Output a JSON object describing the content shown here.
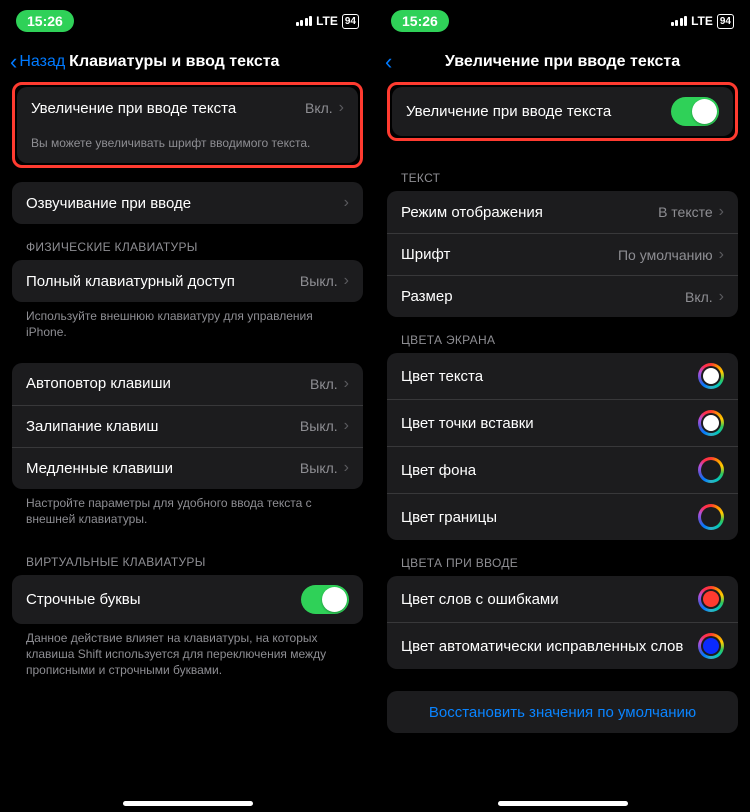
{
  "status": {
    "time": "15:26",
    "network": "LTE",
    "battery": "94"
  },
  "left": {
    "back_label": "Назад",
    "title": "Клавиатуры и ввод текста",
    "hover": {
      "label": "Увеличение при вводе текста",
      "value": "Вкл.",
      "footer": "Вы можете увеличивать шрифт вводимого текста."
    },
    "speak": {
      "label": "Озвучивание при вводе"
    },
    "phys_header": "ФИЗИЧЕСКИЕ КЛАВИАТУРЫ",
    "fullkb": {
      "label": "Полный клавиатурный доступ",
      "value": "Выкл."
    },
    "phys_footer": "Используйте внешнюю клавиатуру для управления iPhone.",
    "keyrepeat": {
      "label": "Автоповтор клавиши",
      "value": "Вкл."
    },
    "sticky": {
      "label": "Залипание клавиш",
      "value": "Выкл."
    },
    "slow": {
      "label": "Медленные клавиши",
      "value": "Выкл."
    },
    "ext_footer": "Настройте параметры для удобного ввода текста с внешней клавиатуры.",
    "virt_header": "ВИРТУАЛЬНЫЕ КЛАВИАТУРЫ",
    "lowercase": {
      "label": "Строчные буквы"
    },
    "virt_footer": "Данное действие влияет на клавиатуры, на которых клавиша Shift используется для переключения между прописными и строчными буквами."
  },
  "right": {
    "title": "Увеличение при вводе текста",
    "main": {
      "label": "Увеличение при вводе текста"
    },
    "text_header": "ТЕКСТ",
    "display_mode": {
      "label": "Режим отображения",
      "value": "В тексте"
    },
    "font": {
      "label": "Шрифт",
      "value": "По умолчанию"
    },
    "size": {
      "label": "Размер",
      "value": "Вкл."
    },
    "screen_header": "ЦВЕТА ЭКРАНА",
    "text_color": {
      "label": "Цвет текста"
    },
    "insert_color": {
      "label": "Цвет точки вставки"
    },
    "bg_color": {
      "label": "Цвет фона"
    },
    "border_color": {
      "label": "Цвет границы"
    },
    "input_header": "ЦВЕТА ПРИ ВВОДЕ",
    "misspell_color": {
      "label": "Цвет слов с ошибками"
    },
    "autocorrect_color": {
      "label": "Цвет автоматически исправленных слов"
    },
    "reset": "Восстановить значения по умолчанию"
  }
}
